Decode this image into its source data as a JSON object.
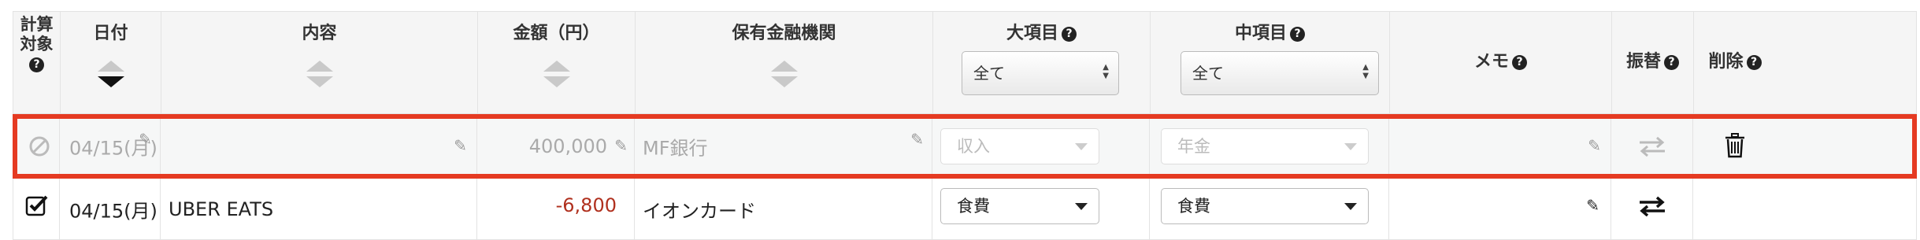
{
  "header": {
    "calc_target": "計算対象",
    "date": "日付",
    "content": "内容",
    "amount": "金額（円）",
    "institution": "保有金融機関",
    "major_category": "大項目",
    "minor_category": "中項目",
    "memo": "メモ",
    "transfer": "振替",
    "delete": "削除",
    "help_glyph": "?",
    "major_filter_value": "全て",
    "minor_filter_value": "全て"
  },
  "rows": [
    {
      "state": "excluded",
      "date": "04/15(月)",
      "content": "",
      "amount": "400,000",
      "institution": "MF銀行",
      "major_category": "収入",
      "minor_category": "年金",
      "highlight_color": "#e53a22"
    },
    {
      "state": "included",
      "date": "04/15(月)",
      "content": "UBER EATS",
      "amount": "-6,800",
      "institution": "イオンカード",
      "major_category": "食費",
      "minor_category": "食費"
    }
  ],
  "icons": {
    "excluded": "ban-icon",
    "included": "checkbox-checked-icon",
    "edit": "pencil-icon",
    "transfer": "transfer-arrows-icon",
    "delete": "trash-icon",
    "help": "question-circle-icon"
  },
  "colors": {
    "negative_amount": "#b0301e",
    "highlight_border": "#e53a22"
  }
}
